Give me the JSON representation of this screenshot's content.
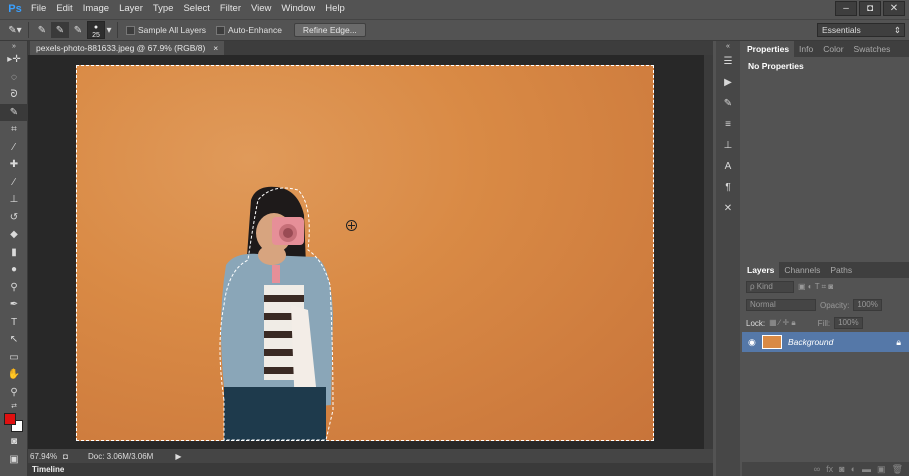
{
  "app": {
    "logo": "Ps"
  },
  "menu": [
    "File",
    "Edit",
    "Image",
    "Layer",
    "Type",
    "Select",
    "Filter",
    "View",
    "Window",
    "Help"
  ],
  "window_controls": [
    "–",
    "◘",
    "✕"
  ],
  "options": {
    "brush_size": "25",
    "sample_all_layers": "Sample All Layers",
    "auto_enhance": "Auto-Enhance",
    "refine_edge": "Refine Edge...",
    "workspace": "Essentials"
  },
  "document": {
    "tab_title": "pexels-photo-881633.jpeg @ 67.9% (RGB/8)",
    "tab_close": "×",
    "zoom": "67.94%",
    "doc_info": "Doc: 3.06M/3.06M",
    "timeline": "Timeline"
  },
  "properties_panel": {
    "tabs": [
      "Properties",
      "Info",
      "Color",
      "Swatches"
    ],
    "body": "No Properties"
  },
  "layers_panel": {
    "tabs": [
      "Layers",
      "Channels",
      "Paths"
    ],
    "filter": "ρ Kind",
    "blend_mode": "Normal",
    "opacity_label": "Opacity:",
    "opacity_value": "100%",
    "lock_label": "Lock:",
    "fill_label": "Fill:",
    "fill_value": "100%",
    "layer_name": "Background"
  },
  "colors": {
    "foreground": "#e01010",
    "background": "#ffffff",
    "photo": "#d98a45"
  }
}
